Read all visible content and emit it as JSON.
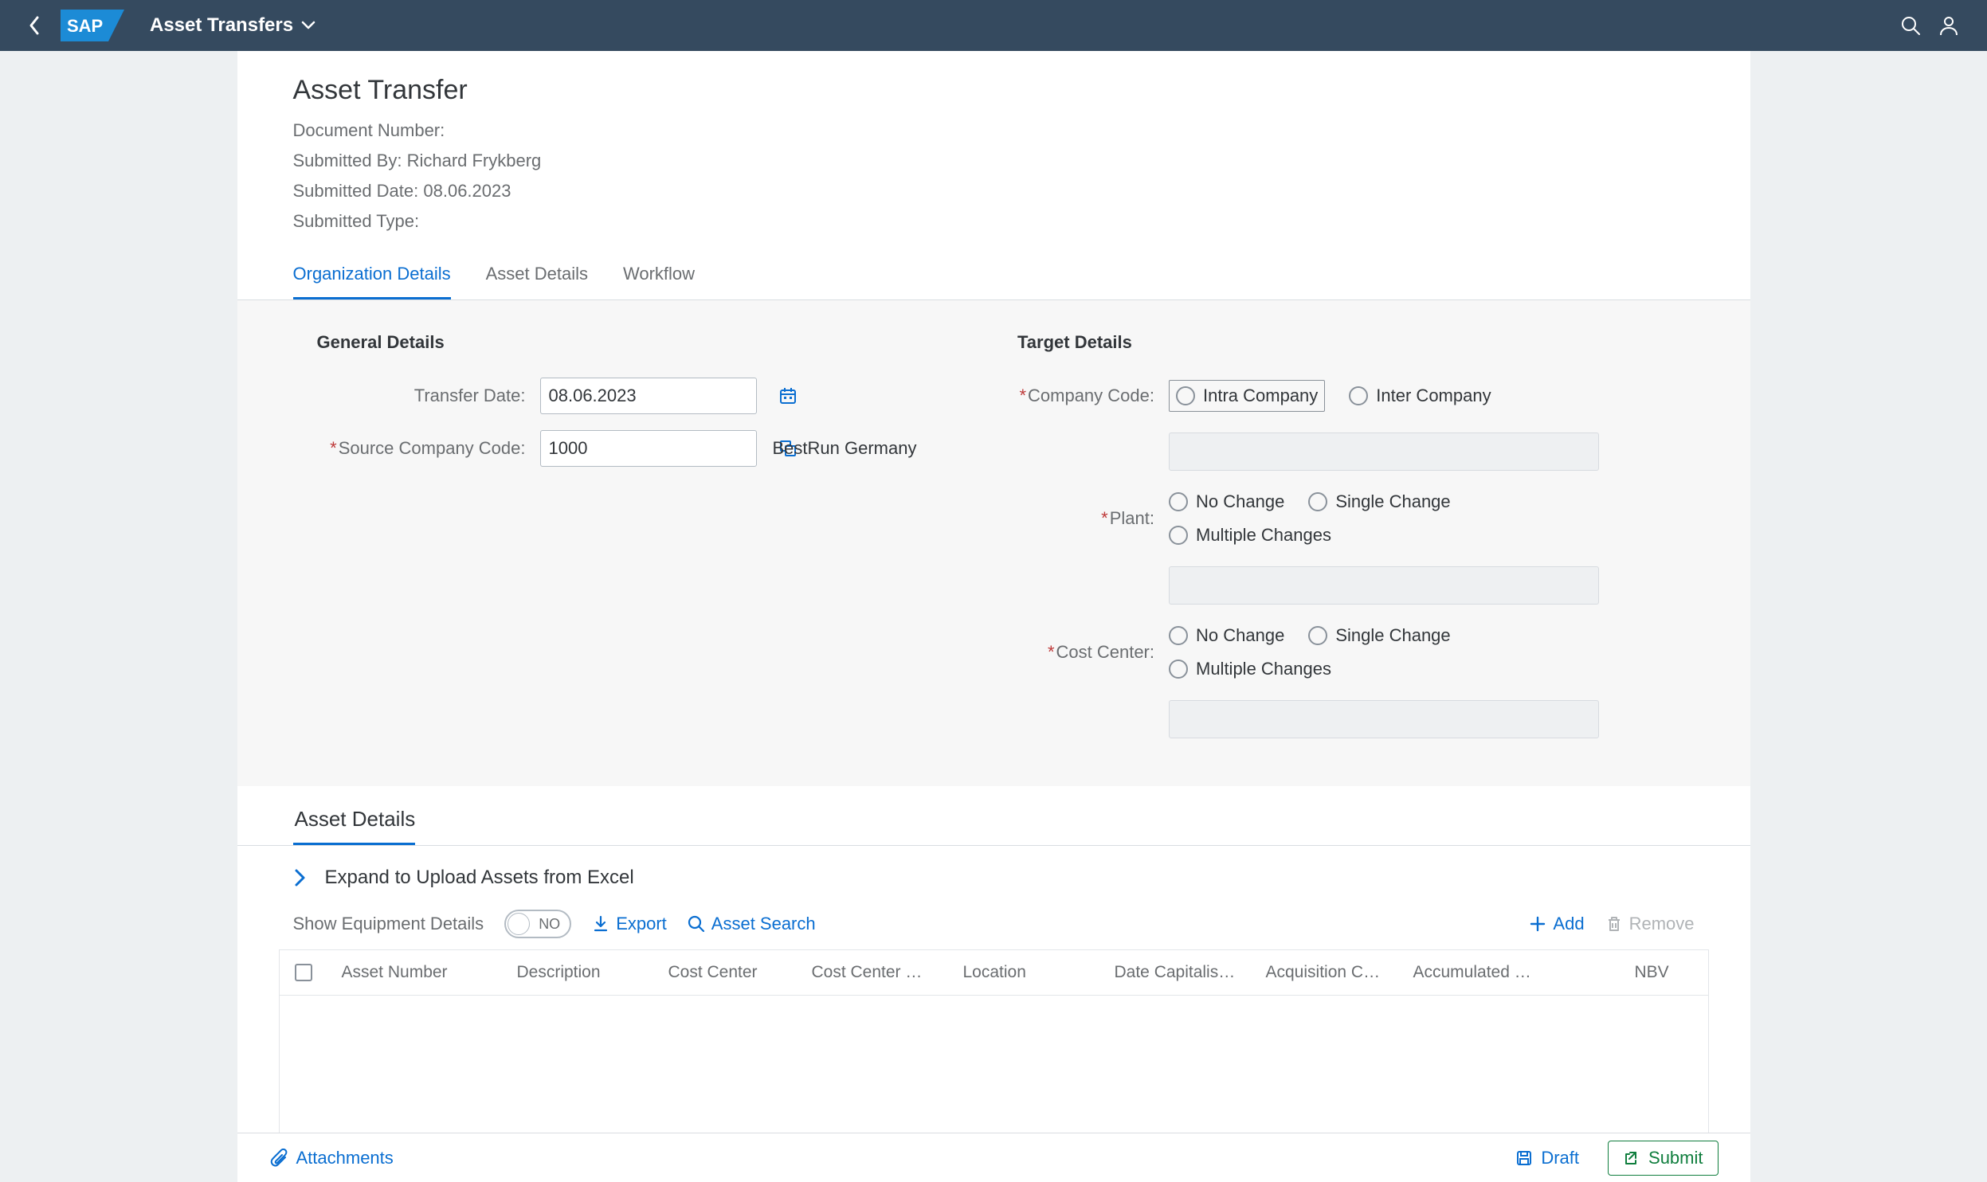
{
  "shell": {
    "title": "Asset Transfers"
  },
  "header": {
    "title": "Asset Transfer",
    "doc_label": "Document Number:",
    "doc_value": "",
    "submitted_by_label": "Submitted By:",
    "submitted_by_value": "Richard Frykberg",
    "submitted_date_label": "Submitted Date:",
    "submitted_date_value": "08.06.2023",
    "submitted_type_label": "Submitted Type:",
    "submitted_type_value": ""
  },
  "tabs": {
    "org": "Organization Details",
    "asset": "Asset Details",
    "workflow": "Workflow"
  },
  "general": {
    "heading": "General Details",
    "transfer_date_label": "Transfer Date:",
    "transfer_date_value": "08.06.2023",
    "source_cc_label": "Source Company Code:",
    "source_cc_value": "1000",
    "source_cc_desc": "BestRun Germany"
  },
  "target": {
    "heading": "Target Details",
    "company_code_label": "Company Code:",
    "company_intra": "Intra Company",
    "company_inter": "Inter Company",
    "plant_label": "Plant:",
    "cost_center_label": "Cost Center:",
    "opt_no_change": "No Change",
    "opt_single": "Single Change",
    "opt_multi": "Multiple Changes"
  },
  "asset_section": {
    "tab": "Asset Details",
    "expand_text": "Expand to Upload Assets from Excel",
    "show_equip": "Show Equipment Details",
    "switch_text": "NO",
    "export": "Export",
    "search": "Asset Search",
    "add": "Add",
    "remove": "Remove",
    "cols": {
      "asset_no": "Asset Number",
      "desc": "Description",
      "cost_center": "Cost Center",
      "cost_center_d": "Cost Center D…",
      "location": "Location",
      "date_cap": "Date Capitalised",
      "acq": "Acquisition Cost",
      "accum": "Accumulated …",
      "nbv": "NBV"
    }
  },
  "footer": {
    "attachments": "Attachments",
    "draft": "Draft",
    "submit": "Submit"
  }
}
